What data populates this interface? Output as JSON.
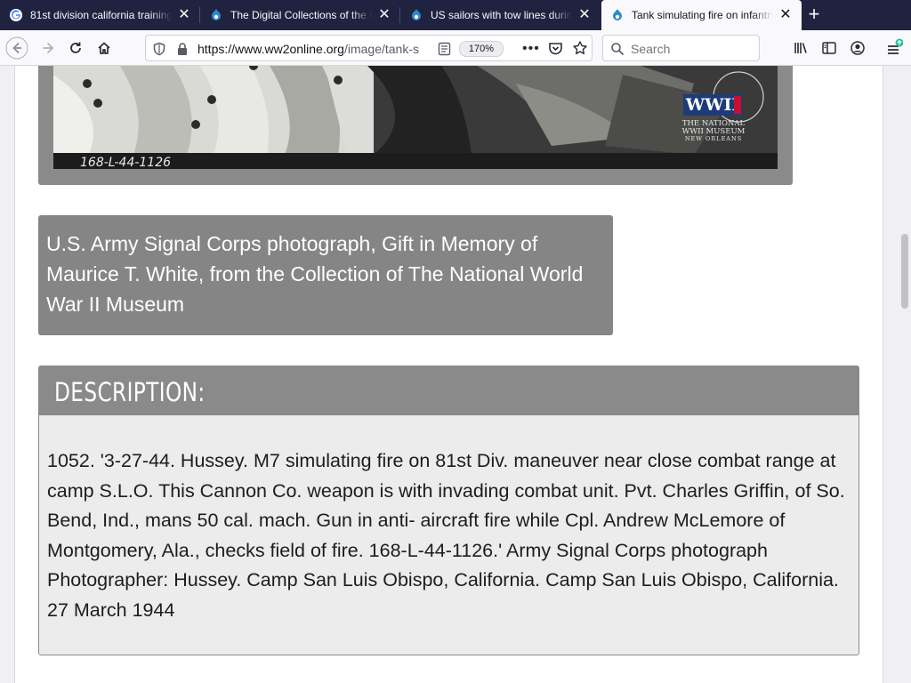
{
  "browser": {
    "tabs": [
      {
        "title": "81st division california training",
        "favicon": "google-icon",
        "active": false
      },
      {
        "title": "The Digital Collections of the N",
        "favicon": "drupal-icon",
        "active": false
      },
      {
        "title": "US sailors with tow lines during",
        "favicon": "drupal-icon",
        "active": false
      },
      {
        "title": "Tank simulating fire on infantry",
        "favicon": "drupal-icon",
        "active": true
      }
    ],
    "url_host": "https://www.ww2online.org",
    "url_path": "/image/tank-s",
    "zoom": "170%",
    "search_placeholder": "Search"
  },
  "photo": {
    "negative_number": "168-L-44-1126",
    "watermark_line1": "THE NATIONAL",
    "watermark_line2": "WWII MUSEUM",
    "watermark_line3": "NEW ORLEANS",
    "logo_text": "WWII"
  },
  "caption": "U.S. Army Signal Corps photograph, Gift in Memory of Maurice T. White, from the Collection of The National World War II Museum",
  "description": {
    "heading": "DESCRIPTION:",
    "body": "1052. '3-27-44. Hussey. M7 simulating fire on 81st Div. maneuver near close combat range at camp S.L.O. This Cannon Co. weapon is with invading combat unit. Pvt. Charles Griffin, of So. Bend, Ind., mans 50 cal. mach. Gun in anti- aircraft fire while Cpl. Andrew McLemore of Montgomery, Ala., checks field of fire. 168-L-44-1126.' Army Signal Corps photograph Photographer: Hussey. Camp San Luis Obispo, California. Camp San Luis Obispo, California. 27 March 1944"
  }
}
